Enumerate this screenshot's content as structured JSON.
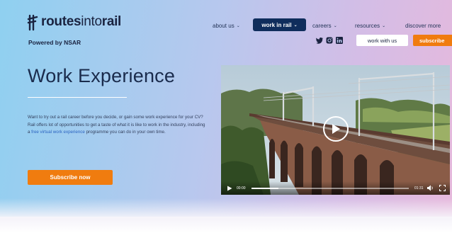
{
  "brand": {
    "logo_bold_1": "routes",
    "logo_light": "into",
    "logo_bold_2": "rail",
    "tagline": "Powered by NSAR"
  },
  "nav": {
    "items": [
      {
        "label": "about us",
        "active": false
      },
      {
        "label": "work in rail",
        "active": true
      },
      {
        "label": "careers",
        "active": false
      },
      {
        "label": "resources",
        "active": false
      },
      {
        "label": "discover more",
        "active": false
      }
    ],
    "social_icons": [
      "twitter-icon",
      "instagram-icon",
      "linkedin-icon"
    ],
    "work_with_us_label": "work with us",
    "subscribe_label": "subscribe"
  },
  "hero": {
    "title": "Work Experience",
    "description_before_link": "Want to try out a rail career before you decide, or gain some work experience for your CV? Rail offers lot of opportunities to get a taste of what it is like to work in the industry, including a ",
    "description_link": "free virtual work experience",
    "description_after_link": " programme you can do in your own time.",
    "cta_label": "Subscribe now"
  },
  "video": {
    "current_time": "00:00",
    "duration": "01:31",
    "progress": 0.17
  },
  "colors": {
    "navy": "#0f2d5c",
    "orange": "#f07c0f",
    "link_blue": "#2b63c0",
    "text_dark": "#1a2b4c"
  }
}
